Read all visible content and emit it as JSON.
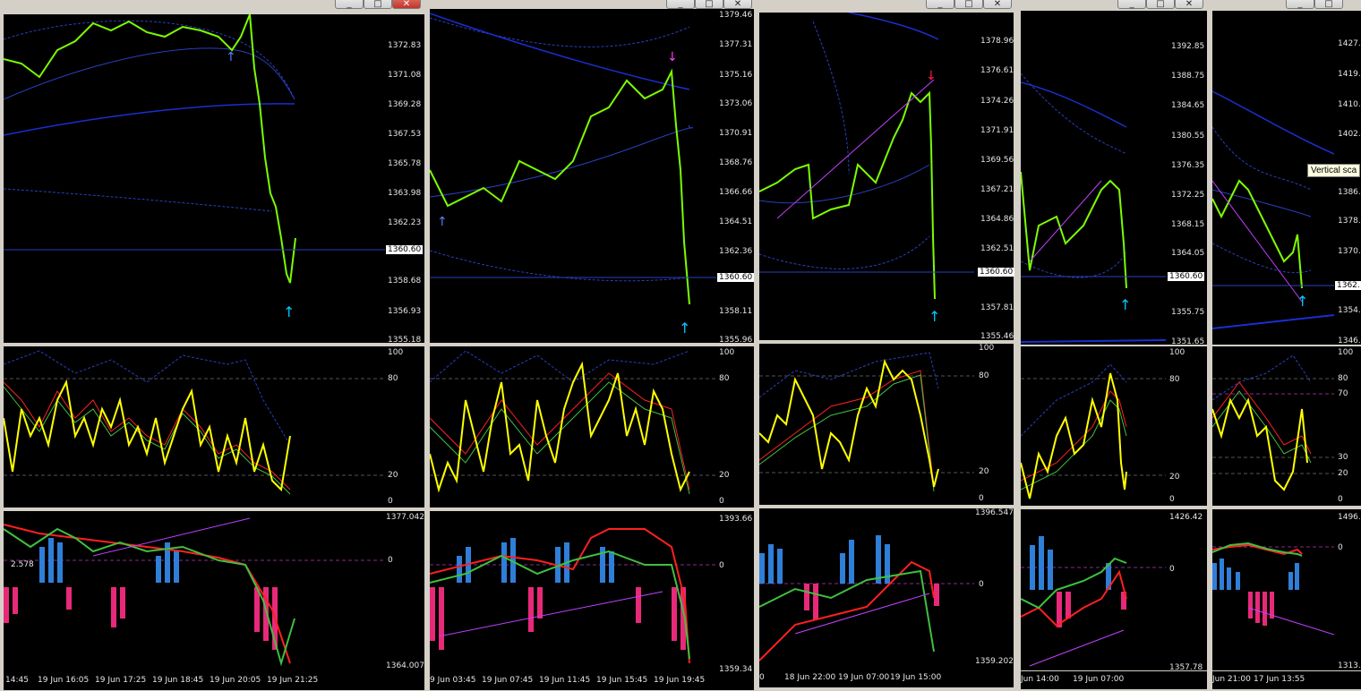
{
  "windows": [
    {
      "id": "w1",
      "price_levels": [
        "1372.83",
        "1371.08",
        "1369.28",
        "1367.53",
        "1365.78",
        "1363.98",
        "1362.23",
        "1358.68",
        "1356.93",
        "1355.18"
      ],
      "current_price": "1360.60",
      "osc_levels": [
        "100",
        "80",
        "20",
        "0"
      ],
      "macd_levels": [
        "1377.042",
        "0",
        "1364.007"
      ],
      "macd_note": "2.578",
      "time_labels": [
        "14:45",
        "19 Jun 16:05",
        "19 Jun 17:25",
        "19 Jun 18:45",
        "19 Jun 20:05",
        "19 Jun 21:25"
      ]
    },
    {
      "id": "w2",
      "price_levels": [
        "1379.46",
        "1377.31",
        "1375.16",
        "1373.06",
        "1370.91",
        "1368.76",
        "1366.66",
        "1364.51",
        "1362.36",
        "1358.11",
        "1355.96"
      ],
      "current_price": "1360.60",
      "osc_levels": [
        "100",
        "80",
        "20",
        "0"
      ],
      "macd_levels": [
        "1393.66",
        "0",
        "1359.34"
      ],
      "time_labels": [
        "9 Jun 03:45",
        "19 Jun 07:45",
        "19 Jun 11:45",
        "19 Jun 15:45",
        "19 Jun 19:45"
      ]
    },
    {
      "id": "w3",
      "price_levels": [
        "1378.96",
        "1376.61",
        "1374.26",
        "1371.91",
        "1369.56",
        "1367.21",
        "1364.86",
        "1362.51",
        "1357.81",
        "1355.46"
      ],
      "current_price": "1360.60",
      "osc_levels": [
        "100",
        "80",
        "20",
        "0"
      ],
      "macd_levels": [
        "1396.547",
        "0",
        "1359.202"
      ],
      "time_labels": [
        "0",
        "18 Jun 22:00",
        "19 Jun 07:00",
        "19 Jun 15:00"
      ]
    },
    {
      "id": "w4",
      "price_levels": [
        "1392.85",
        "1388.75",
        "1384.65",
        "1380.55",
        "1376.35",
        "1372.25",
        "1368.15",
        "1364.05",
        "1355.75",
        "1351.65"
      ],
      "current_price": "1360.60",
      "osc_levels": [
        "100",
        "80",
        "20",
        "0"
      ],
      "macd_levels": [
        "1426.42",
        "0",
        "1357.78"
      ],
      "time_labels": [
        "Jun 14:00",
        "19 Jun 07:00"
      ]
    },
    {
      "id": "w5",
      "price_levels": [
        "1427.",
        "1419.",
        "1410.",
        "1402.",
        "1386.",
        "1378.",
        "1370.",
        "1362.",
        "1354.",
        "1346."
      ],
      "current_price": "1362.",
      "osc_levels": [
        "100",
        "80",
        "70",
        "30",
        "20",
        "0"
      ],
      "macd_levels": [
        "1496.",
        "0",
        "1313."
      ],
      "time_labels": [
        "Jun 21:00",
        "17 Jun 13:55"
      ]
    }
  ],
  "tooltip": "Vertical sca",
  "window_buttons": {
    "minimize": "_",
    "maximize": "□",
    "close": "✕"
  },
  "colors": {
    "background": "#000000",
    "candle": "#7cfc00",
    "band": "#2a3fbf",
    "stoch": "#ffff00",
    "hist_up": "#2f7fd8",
    "hist_down": "#e8297a",
    "signal_red": "#ff2020",
    "signal_green": "#40c040",
    "arrow_up": "#00c8ff",
    "arrow_down": "#ff2040"
  }
}
